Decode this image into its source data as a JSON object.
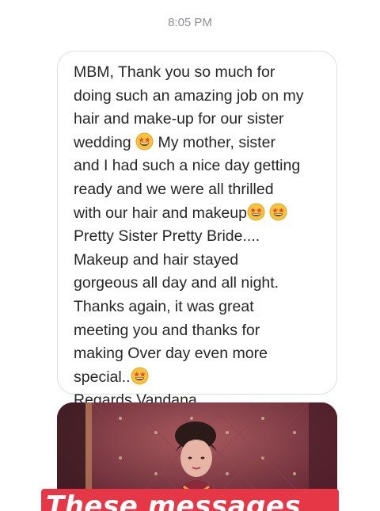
{
  "status": {
    "timestamp": "8:05 PM"
  },
  "message": {
    "lines": [
      "MBM, Thank you so much for",
      "doing such an amazing job on my",
      "hair and make-up for our sister",
      "wedding",
      "My mother, sister",
      "and I had such a nice day getting",
      "ready and we were all thrilled",
      "with our hair and makeup",
      "Pretty Sister Pretty Bride....",
      "Makeup and hair stayed",
      "gorgeous all day and all night.",
      "Thanks again, it was great",
      "meeting you and thanks for",
      "making Over day even more",
      "special..",
      "Regards Vandana"
    ],
    "emoji_icon": "star-struck-emoji-icon"
  },
  "photo": {
    "banner_text": "These messages",
    "colors": {
      "banner": "#e63746",
      "background": "#7a2f3a"
    }
  }
}
